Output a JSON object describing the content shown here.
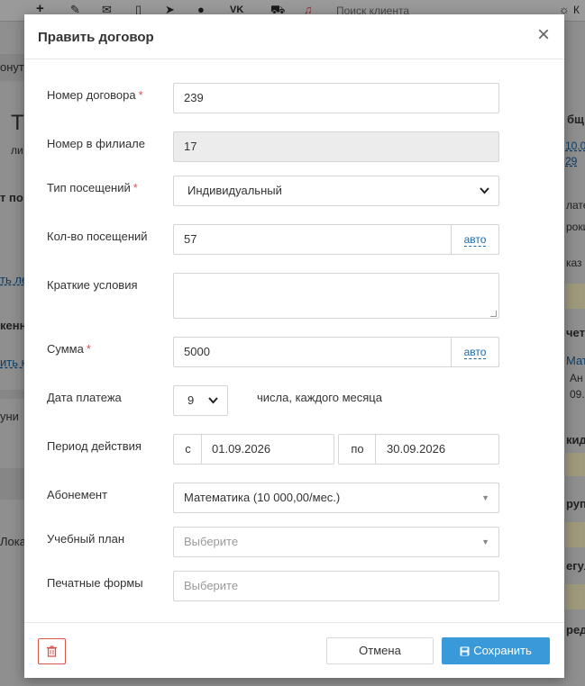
{
  "background": {
    "search_placeholder": "Поиск клиента",
    "fragments": {
      "f1": "онут",
      "f2": "Т",
      "f3": "ли",
      "f4": "т по",
      "f5": "ть ле",
      "f6": "кенн",
      "f7": "ить н",
      "f8": "уни",
      "f9": "Лока",
      "r1": "бщ",
      "r2": "10.0",
      "r3": "29",
      "r4": "лате",
      "r5": "роки",
      "r6": "каз",
      "r7": "чета",
      "r8": "Мат",
      "r9": "Ан",
      "r10": "09.",
      "r11": "кид",
      "r12": "рупп",
      "r13": "егул",
      "r14": "ред"
    },
    "topbar_icons": [
      "plus-icon",
      "wrench-icon",
      "mail-icon",
      "phone-icon",
      "telegram-icon",
      "ok-icon",
      "vk-icon",
      "cart-icon",
      "bell-icon",
      "light-icon"
    ]
  },
  "modal": {
    "title": "Править договор",
    "fields": {
      "contract_number": {
        "label": "Номер договора",
        "value": "239",
        "required": true
      },
      "branch_number": {
        "label": "Номер в филиале",
        "value": "17"
      },
      "visit_type": {
        "label": "Тип посещений",
        "value": "Индивидуальный",
        "required": true
      },
      "visits_count": {
        "label": "Кол-во посещений",
        "value": "57",
        "addon": "авто"
      },
      "short_terms": {
        "label": "Краткие условия",
        "value": ""
      },
      "amount": {
        "label": "Сумма",
        "value": "5000",
        "addon": "авто",
        "required": true
      },
      "payment_date": {
        "label": "Дата платежа",
        "value": "9",
        "suffix": "числа, каждого месяца"
      },
      "period": {
        "label": "Период действия",
        "from_label": "с",
        "from": "01.09.2026",
        "to_label": "по",
        "to": "30.09.2026"
      },
      "subscription": {
        "label": "Абонемент",
        "value": "Математика (10 000,00/мес.)"
      },
      "study_plan": {
        "label": "Учебный план",
        "placeholder": "Выберите"
      },
      "print_forms": {
        "label": "Печатные формы",
        "placeholder": "Выберите"
      }
    },
    "footer": {
      "cancel_label": "Отмена",
      "save_label": "Сохранить"
    },
    "colors": {
      "primary": "#3a9ad9",
      "danger": "#d9534f",
      "link": "#1e6aa5"
    }
  }
}
